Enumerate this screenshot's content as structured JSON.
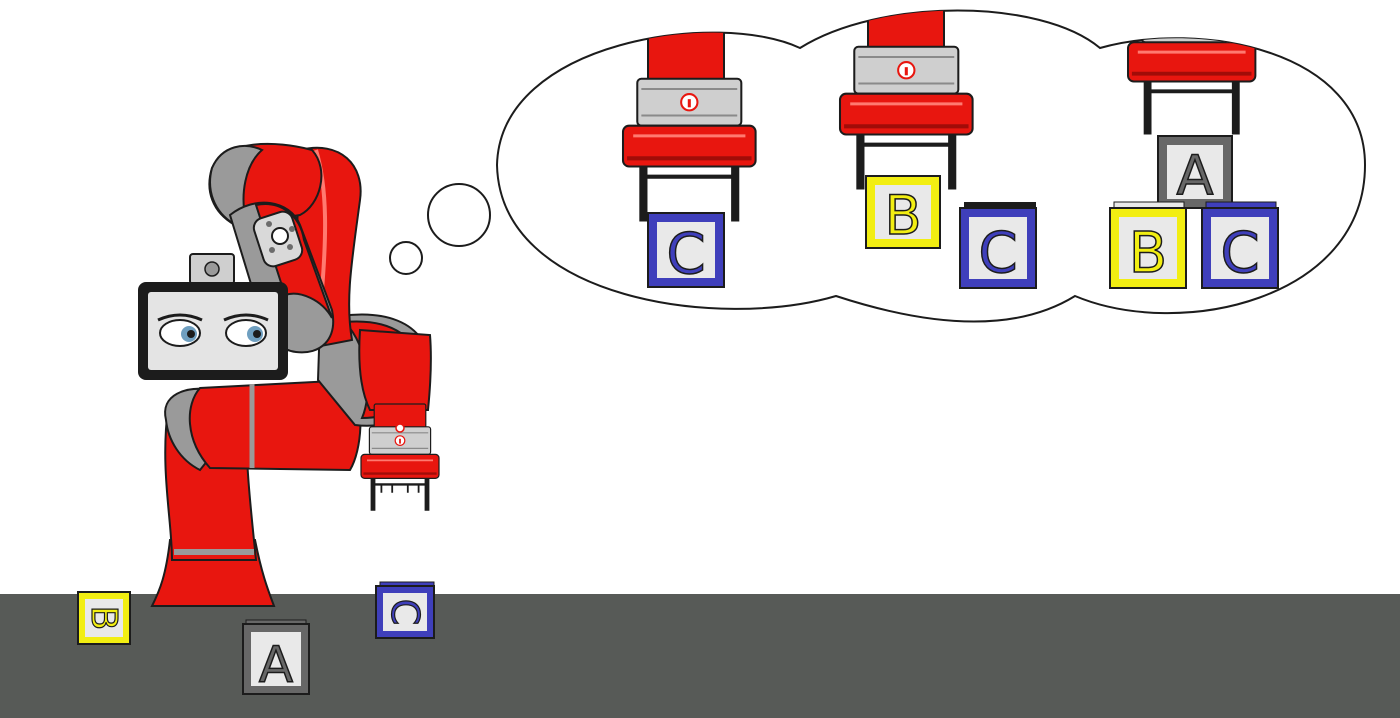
{
  "colors": {
    "floor": "#575a57",
    "robot_red": "#e8160f",
    "robot_red_dark": "#a10c08",
    "robot_gray": "#9a9a9a",
    "robot_gray_dark": "#6c6c6c",
    "outline": "#1c1c1c",
    "block_yellow": "#f2ee12",
    "block_blue": "#3f3fbb",
    "block_gray": "#676767",
    "block_face": "#e9e9e9",
    "eye_color": "#6f9fc0"
  },
  "floor_blocks": {
    "b": {
      "letter": "B"
    },
    "a": {
      "letter": "A"
    },
    "c": {
      "letter": "C"
    }
  },
  "thought_steps": {
    "step1": {
      "held": "C"
    },
    "step2": {
      "held": "B",
      "table": "C"
    },
    "step3": {
      "held": "A",
      "left": "B",
      "right": "C"
    }
  },
  "icons": {
    "gripper_badge": "info-icon"
  }
}
